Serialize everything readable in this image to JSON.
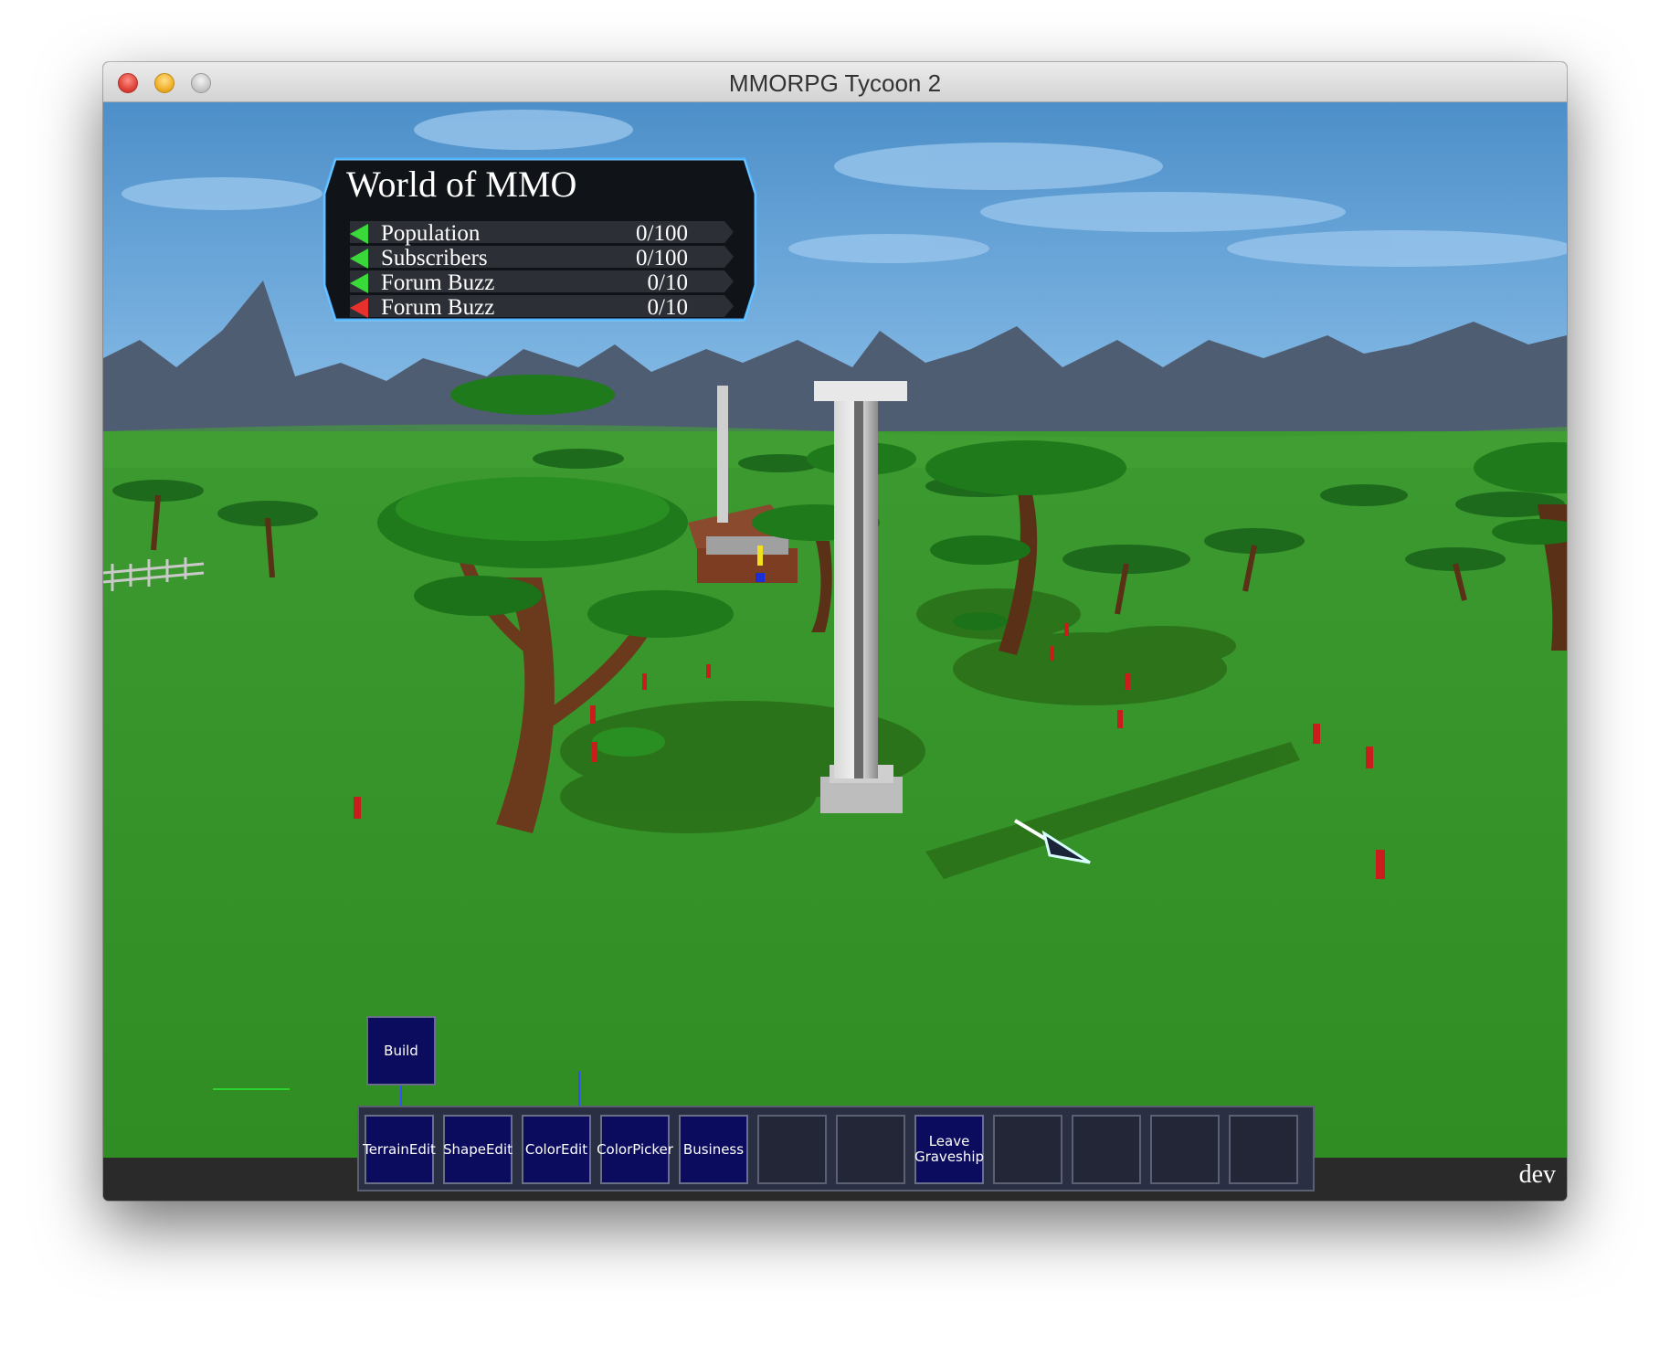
{
  "window": {
    "title": "MMORPG Tycoon 2"
  },
  "hud": {
    "title": "World of MMO",
    "stats": [
      {
        "label": "Population",
        "value": "0/100",
        "trend": "up",
        "color": "#3ad93a"
      },
      {
        "label": "Subscribers",
        "value": "0/100",
        "trend": "up",
        "color": "#3ad93a"
      },
      {
        "label": "Forum Buzz",
        "value": "0/10",
        "trend": "up",
        "color": "#3ad93a"
      },
      {
        "label": "Forum Buzz",
        "value": "0/10",
        "trend": "down",
        "color": "#e8302c"
      }
    ]
  },
  "toolbar": {
    "build_label": "Build",
    "slots": [
      "TerrainEdit",
      "ShapeEdit",
      "ColorEdit",
      "ColorPicker",
      "Business",
      "",
      "",
      "Leave Graveship",
      "",
      "",
      "",
      ""
    ]
  },
  "status": {
    "mode_label": "dev"
  },
  "colors": {
    "sky": "#6fa8d8",
    "grass": "#3e9a2c",
    "mountains": "#4b5a70",
    "button_fill": "#0c0c5e",
    "toolbar_bg": "#2a2f44"
  }
}
